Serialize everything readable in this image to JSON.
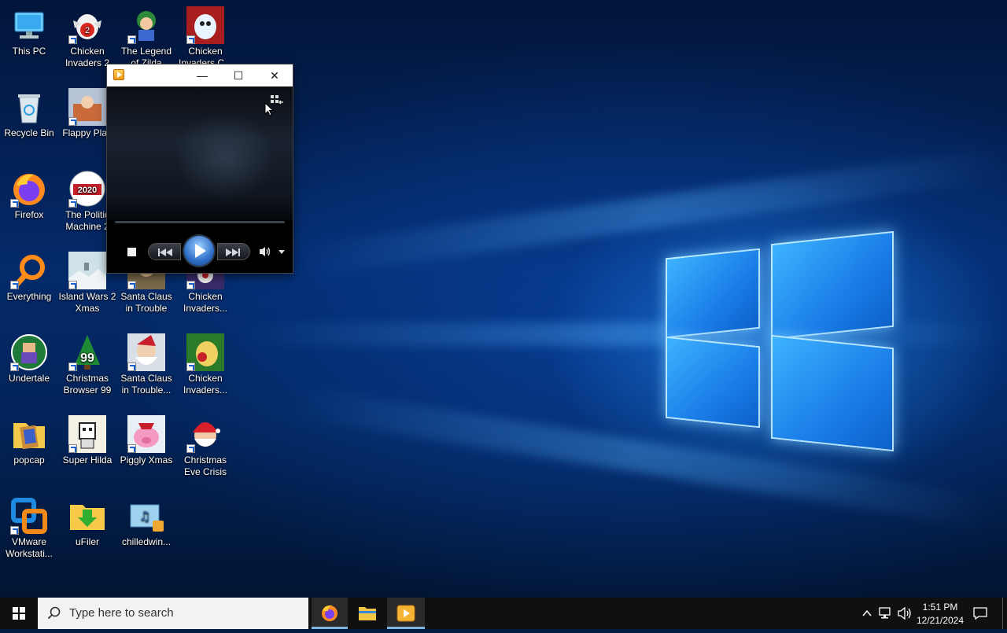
{
  "desktop": {
    "icons": [
      {
        "label": "This PC"
      },
      {
        "label": "Chicken Invaders 2"
      },
      {
        "label": "The Legend of Zilda"
      },
      {
        "label": "Chicken Invaders C..."
      },
      {
        "label": "Recycle Bin"
      },
      {
        "label": "Flappy Plan"
      },
      {
        "label": "Firefox"
      },
      {
        "label": "The Politic Machine 2"
      },
      {
        "label": "Everything"
      },
      {
        "label": "Island Wars 2 Xmas"
      },
      {
        "label": "Santa Claus in Trouble"
      },
      {
        "label": "Chicken Invaders..."
      },
      {
        "label": "Undertale"
      },
      {
        "label": "Christmas Browser 99"
      },
      {
        "label": "Santa Claus in Trouble..."
      },
      {
        "label": "Chicken Invaders..."
      },
      {
        "label": "popcap"
      },
      {
        "label": "Super Hilda"
      },
      {
        "label": "Piggly Xmas"
      },
      {
        "label": "Christmas Eve Crisis"
      },
      {
        "label": "VMware Workstati..."
      },
      {
        "label": "uFiler"
      },
      {
        "label": "chilledwin..."
      }
    ]
  },
  "media_player": {
    "minimize": "—",
    "maximize": "☐",
    "close": "✕"
  },
  "taskbar": {
    "search_placeholder": "Type here to search",
    "time": "1:51 PM",
    "date": "12/21/2024"
  },
  "colors": {
    "taskbar_bg": "#101010",
    "accent": "#0078d7",
    "window_bg": "#000000"
  }
}
